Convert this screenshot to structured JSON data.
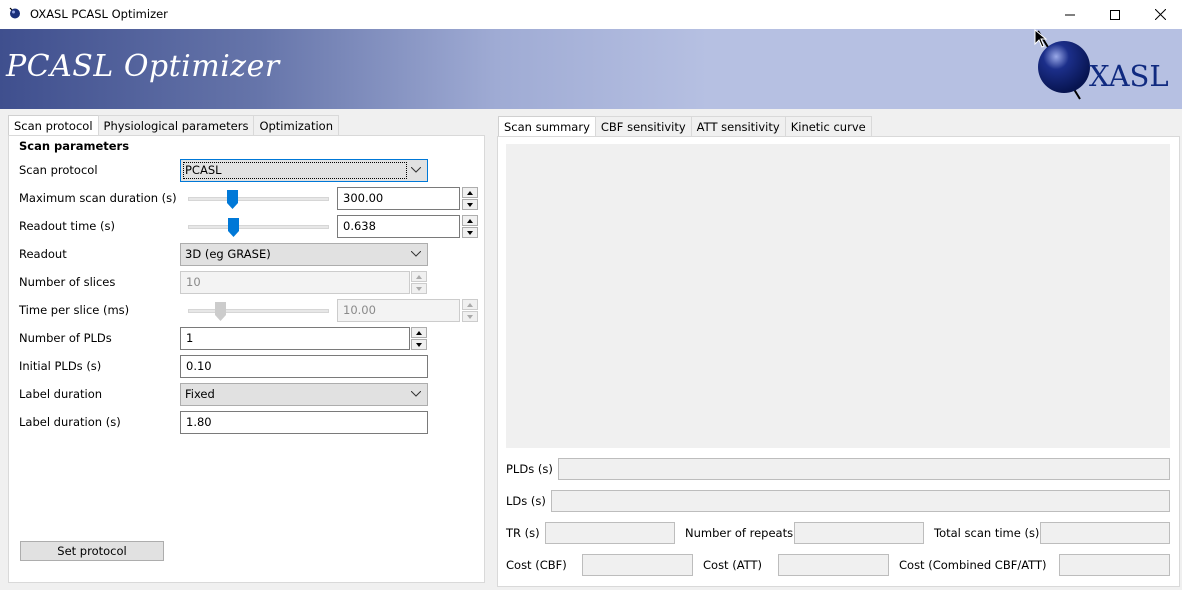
{
  "window": {
    "title": "OXASL PCASL Optimizer",
    "controls": {
      "minimize": "—",
      "maximize": "☐",
      "close": "✕"
    }
  },
  "banner": {
    "title": "PCASL Optimizer",
    "logo_text": "XASL",
    "colors": {
      "left": "#3f4f8e",
      "right": "#b6c0e2",
      "logo": "#102a80"
    }
  },
  "left_tabs": [
    "Scan protocol",
    "Physiological parameters",
    "Optimization"
  ],
  "right_tabs": [
    "Scan summary",
    "CBF sensitivity",
    "ATT sensitivity",
    "Kinetic curve"
  ],
  "scan_parameters": {
    "heading": "Scan parameters",
    "scan_protocol": {
      "label": "Scan protocol",
      "value": "PCASL"
    },
    "max_scan_duration": {
      "label": "Maximum scan duration (s)",
      "value": "300.00",
      "slider_fraction": 0.31
    },
    "readout_time": {
      "label": "Readout time (s)",
      "value": "0.638",
      "slider_fraction": 0.32
    },
    "readout": {
      "label": "Readout",
      "value": "3D (eg GRASE)"
    },
    "number_of_slices": {
      "label": "Number of slices",
      "value": "10"
    },
    "time_per_slice": {
      "label": "Time per slice (ms)",
      "value": "10.00",
      "slider_fraction": 0.23
    },
    "number_of_plds": {
      "label": "Number of PLDs",
      "value": "1"
    },
    "initial_plds": {
      "label": "Initial PLDs (s)",
      "value": "0.10"
    },
    "label_duration_mode": {
      "label": "Label duration",
      "value": "Fixed"
    },
    "label_duration": {
      "label": "Label duration (s)",
      "value": "1.80"
    },
    "set_protocol_button": "Set protocol"
  },
  "summary": {
    "plds_label": "PLDs (s)",
    "lds_label": "LDs (s)",
    "tr_label": "TR (s)",
    "repeats_label": "Number of repeats",
    "total_time_label": "Total scan time (s)",
    "cost_cbf_label": "Cost (CBF)",
    "cost_att_label": "Cost (ATT)",
    "cost_combined_label": "Cost (Combined CBF/ATT)"
  }
}
